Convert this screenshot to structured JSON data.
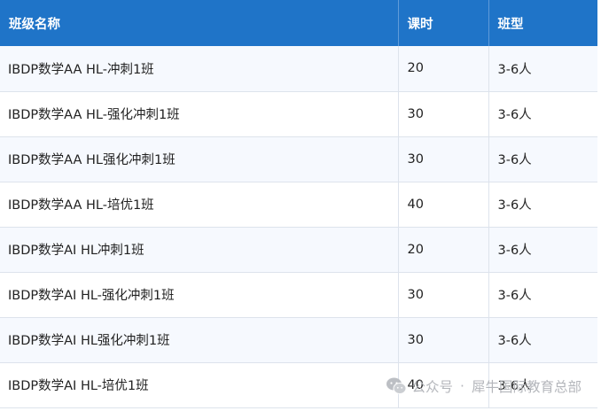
{
  "table": {
    "headers": [
      "班级名称",
      "课时",
      "班型"
    ],
    "rows": [
      [
        "IBDP数学AA HL-冲刺1班",
        "20",
        "3-6人"
      ],
      [
        "IBDP数学AA HL-强化冲刺1班",
        "30",
        "3-6人"
      ],
      [
        "IBDP数学AA HL强化冲刺1班",
        "30",
        "3-6人"
      ],
      [
        "IBDP数学AA HL-培优1班",
        "40",
        "3-6人"
      ],
      [
        "IBDP数学AI HL冲刺1班",
        "20",
        "3-6人"
      ],
      [
        "IBDP数学AI HL-强化冲刺1班",
        "30",
        "3-6人"
      ],
      [
        "IBDP数学AI HL强化冲刺1班",
        "30",
        "3-6人"
      ],
      [
        "IBDP数学AI HL-培优1班",
        "40",
        "3-6人"
      ]
    ]
  },
  "watermark": {
    "prefix": "公众号",
    "separator": "·",
    "name": "犀牛国际教育总部",
    "icon": "wechat-icon"
  },
  "colors": {
    "header_bg": "#1f74c8",
    "header_text": "#ffffff",
    "row_alt_bg": "#f6f9fe",
    "border": "#dde3ec",
    "watermark": "#b0b3b8"
  }
}
